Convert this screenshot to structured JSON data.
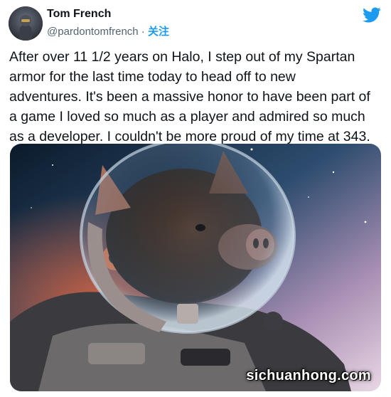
{
  "author": {
    "name": "Tom French",
    "handle": "@pardontomfrench",
    "separator": " · ",
    "follow_label": "关注"
  },
  "icons": {
    "brand": "twitter-bird-icon",
    "avatar": "avatar-image"
  },
  "colors": {
    "brand": "#1d9bf0",
    "text": "#0f1419",
    "muted": "#536471"
  },
  "tweet": {
    "text": "After over 11 1/2 years on Halo, I step out of my Spartan\narmor for the last time today to head off to new\nadventures. It's been a massive honor to have been part of\na game I loved so much as a player and admired so much\nas a developer. I couldn't be more proud of my time at 343."
  },
  "media": {
    "watermark": "sichuanhong.com"
  }
}
